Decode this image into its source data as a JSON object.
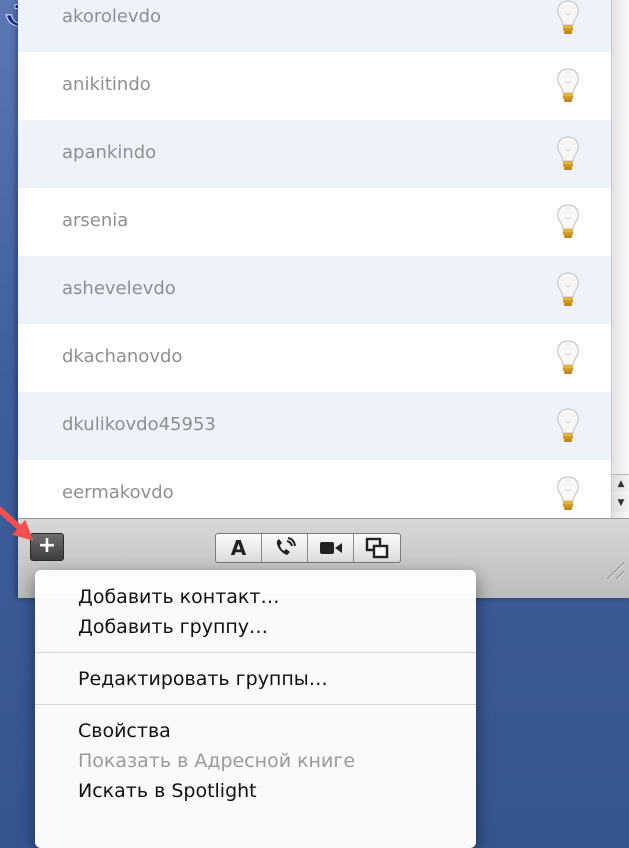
{
  "decor": {
    "title_fragment": "ЭВ"
  },
  "buddy_list": {
    "contacts": [
      {
        "name": "akorolevdo",
        "status_icon": "lightbulb-icon"
      },
      {
        "name": "anikitindo",
        "status_icon": "lightbulb-icon"
      },
      {
        "name": "apankindo",
        "status_icon": "lightbulb-icon"
      },
      {
        "name": "arsenia",
        "status_icon": "lightbulb-icon"
      },
      {
        "name": "ashevelevdo",
        "status_icon": "lightbulb-icon"
      },
      {
        "name": "dkachanovdo",
        "status_icon": "lightbulb-icon"
      },
      {
        "name": "dkulikovdo45953",
        "status_icon": "lightbulb-icon"
      },
      {
        "name": "eermakovdo",
        "status_icon": "lightbulb-icon"
      }
    ],
    "row_colors": {
      "alt": "#edf2fb",
      "plain": "#ffffff"
    }
  },
  "toolbar": {
    "add_button": {
      "label": "+",
      "icon": "plus-icon"
    },
    "segments": [
      {
        "icon": "text-chat-icon",
        "glyph": "A"
      },
      {
        "icon": "audio-chat-icon"
      },
      {
        "icon": "video-chat-icon"
      },
      {
        "icon": "screen-sharing-icon"
      }
    ]
  },
  "context_menu": {
    "group1": {
      "add_contact": "Добавить контакт…",
      "add_group": "Добавить группу…"
    },
    "group2": {
      "edit_groups": "Редактировать группы…"
    },
    "group3": {
      "properties": "Свойства",
      "show_in_address_book": "Показать в Адресной книге",
      "search_in_spotlight": "Искать в Spotlight"
    }
  },
  "colors": {
    "desktop": "#3f5e9e",
    "annotation_arrow": "#f05050",
    "title_fragment": "#1a2f9a"
  }
}
